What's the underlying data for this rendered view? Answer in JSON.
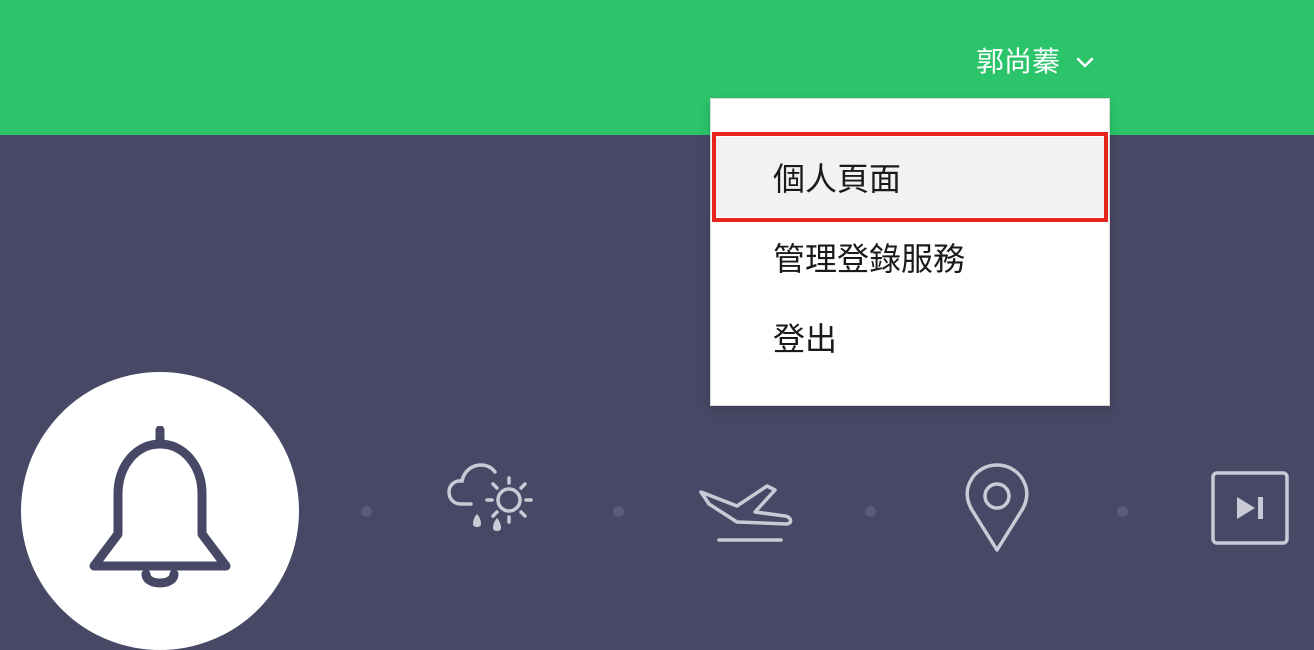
{
  "header": {
    "user_name": "郭尚蓁",
    "background_color": "#2bc46a",
    "chevron_icon": "chevron-down-icon"
  },
  "user_dropdown": {
    "items": [
      {
        "label": "個人頁面",
        "highlighted": true
      },
      {
        "label": "管理登錄服務",
        "highlighted": false
      },
      {
        "label": "登出",
        "highlighted": false
      }
    ],
    "highlight_color": "#e8241f"
  },
  "main": {
    "background_color": "#474865",
    "feature_icons": [
      "bell-icon",
      "weather-icon",
      "flight-icon",
      "location-pin-icon",
      "skip-next-icon"
    ]
  }
}
